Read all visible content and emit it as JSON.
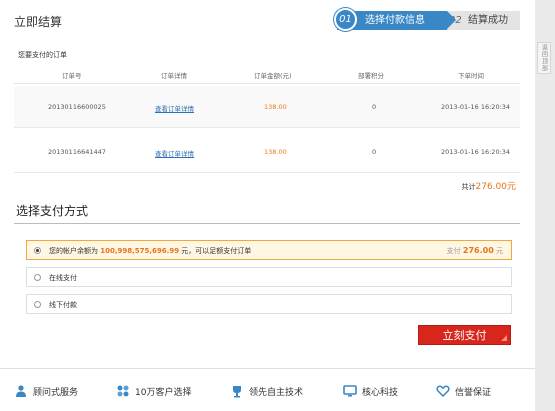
{
  "header": {
    "title": "立即结算"
  },
  "steps": [
    {
      "num": "01",
      "label": "选择付款信息"
    },
    {
      "num": "02",
      "label": "结算成功"
    }
  ],
  "side_tab": {
    "label": "返回顶部"
  },
  "orders": {
    "title": "您要支付的订单",
    "columns": [
      "订单号",
      "订单详情",
      "订单金额(元)",
      "部署积分",
      "下单时间"
    ],
    "rows": [
      {
        "id": "20130116600025",
        "detail": "查看订单详情",
        "amount": "138.00",
        "points": "0",
        "time": "2013-01-16 16:20:34"
      },
      {
        "id": "20130116641447",
        "detail": "查看订单详情",
        "amount": "138.00",
        "points": "0",
        "time": "2013-01-16 16:20:34"
      }
    ],
    "total_label": "共计",
    "total_value": "276.00元"
  },
  "payment": {
    "title": "选择支付方式",
    "options": [
      {
        "pre": "您的帐户余额为 ",
        "balance": "100,998,575,696.99",
        "post": " 元，可以足额支付订单",
        "pay_label": "支付 ",
        "pay_value": "276.00",
        "pay_unit": " 元"
      },
      {
        "label": "在线支付"
      },
      {
        "label": "线下付款"
      }
    ],
    "submit_label": "立刻支付"
  },
  "footer": {
    "items": [
      {
        "icon": "person-icon",
        "label": "顾问式服务"
      },
      {
        "icon": "fan-icon",
        "label": "10万客户选择"
      },
      {
        "icon": "trophy-icon",
        "label": "领先自主技术"
      },
      {
        "icon": "monitor-icon",
        "label": "核心科技"
      },
      {
        "icon": "heart-icon",
        "label": "信誉保证"
      }
    ]
  },
  "colors": {
    "accent": "#3a87c6",
    "price": "#e8741a",
    "button": "#d8261c"
  }
}
